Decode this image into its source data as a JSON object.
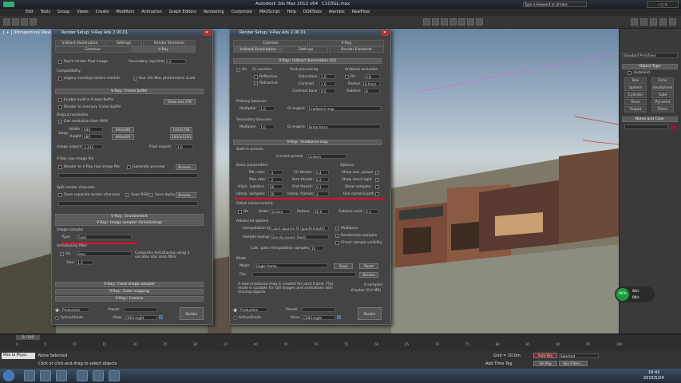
{
  "title_bar": {
    "title": "Autodesk 3ds Max  2012 x64",
    "file": "C103GL.max",
    "search_placeholder": "Type a keyword or phrase"
  },
  "menu": [
    "Edit",
    "Tools",
    "Group",
    "Views",
    "Create",
    "Modifiers",
    "Animation",
    "Graph Editors",
    "Rendering",
    "Customize",
    "MAXScript",
    "Help",
    "DDKTools",
    "Alembic",
    "RealFlow"
  ],
  "viewport": {
    "label": "[ + ] [Perspective] [Realistic]"
  },
  "dialog1": {
    "title": "Render Setup: V-Ray Adv 2.00.01",
    "tabs": [
      "Indirect illumination",
      "Settings",
      "Render Elements",
      "Common",
      "V-Ray"
    ],
    "rollouts": {
      "frame_buffer": "V-Ray:: Frame buffer",
      "environment": "V-Ray:: Environment",
      "image_sampler": "V-Ray:: Image sampler (Antialiasing)",
      "fixed_sampler": "V-Ray:: Fixed image sampler",
      "color_mapping": "V-Ray:: Color mapping",
      "camera": "V-Ray:: Camera"
    },
    "lines": {
      "dont_render": "Don't render final image",
      "secondary_rays": "Secondary rays bias",
      "secondary_value": "0.0",
      "compat": "Compatibility",
      "legacy": "Legacy sun/sky/camera models",
      "photometric": "Use 3ds Max photometric scale",
      "enable_fb": "Enable built-in Frame Buffer",
      "render_memory": "Render to memory frame buffer",
      "show_last": "Show last VFB",
      "output_res": "Output resolution",
      "get_res": "Get resolution from MAX",
      "width": "Width",
      "width_val": "640",
      "height": "Height",
      "height_val": "480",
      "swap": "Swap",
      "r640": "640x480",
      "r1024": "1024x768",
      "r800": "800x600",
      "r1600": "1600x1200",
      "image_aspect": "Image aspect:",
      "image_aspect_val": "1.333",
      "pixel_aspect": "Pixel aspect:",
      "pixel_aspect_val": "1.0",
      "vray_raw": "V-Ray raw image file",
      "render_raw": "Render to V-Ray raw image file",
      "gen_preview": "Generate preview",
      "browse": "Browse...",
      "split_channels": "Split render channels",
      "save_split": "Save separate render channels",
      "save_rgb": "Save RGB",
      "save_alpha": "Save alpha",
      "image_sampler_grp": "Image sampler",
      "type": "Type:",
      "type_val": "Fixed",
      "aa_filter": "Antialiasing filter",
      "on": "On",
      "filter_val": "Area",
      "filter_desc": "Computes Antialiasing using a variable size area filter.",
      "size": "Size:",
      "size_val": "1.5"
    },
    "bottom": {
      "production": "Production",
      "activeshade": "ActiveShade",
      "preset": "Preset:",
      "view": "View:",
      "view_val": "C003-night",
      "render": "Render"
    }
  },
  "dialog2": {
    "title": "Render Setup: V-Ray Adv 2.00.01",
    "tabs": [
      "Common",
      "V-Ray",
      "Indirect illumination",
      "Settings",
      "Render Elements"
    ],
    "rollouts": {
      "gi": "V-Ray:: Indirect illumination (GI)",
      "irradiance": "V-Ray:: Irradiance map"
    },
    "lines": {
      "on": "On",
      "gi_caustics": "GI caustics",
      "reflective": "Reflective",
      "refractive": "Refractive",
      "post": "Post-processing",
      "saturation": "Saturation",
      "saturation_val": "1.0",
      "contrast": "Contrast",
      "contrast_val": "1.0",
      "contrast_base": "Contrast base",
      "contrast_base_val": "0.5",
      "ao": "Ambient occlusion",
      "ao_on": "On",
      "ao_val": "0.8",
      "radius": "Radius",
      "radius_val": "10.0mm",
      "subdivs": "Subdivs",
      "subdivs_val": "8",
      "primary": "Primary bounces",
      "multiplier": "Multiplier",
      "mult_val": "1.0",
      "gi_engine": "GI engine",
      "primary_engine": "Irradiance map",
      "secondary": "Secondary bounces",
      "secondary_engine": "Brute force",
      "builtin": "Built-in presets",
      "current_preset": "Current preset:",
      "preset_val": "Custom",
      "basic": "Basic parameters",
      "min_rate": "Min rate:",
      "min_rate_val": "-3",
      "max_rate": "Max rate:",
      "max_rate_val": "-2",
      "hsph": "HSph. subdivs:",
      "hsph_val": "50",
      "interp": "Interp. samples:",
      "interp_val": "20",
      "clr": "Clr thresh:",
      "clr_val": "0.4",
      "nrm": "Nrm thresh:",
      "nrm_val": "0.2",
      "dist": "Dist thresh:",
      "dist_val": "0.1",
      "frames": "Interp. frames:",
      "frames_val": "2",
      "options": "Options",
      "show_calc": "Show calc. phase",
      "show_direct": "Show direct light",
      "show_samples": "Show samples",
      "use_camera": "Use camera path",
      "detail": "Detail enhancement",
      "detail_on": "On",
      "scale": "Scale:",
      "scale_val": "Screen",
      "det_radius": "Radius:",
      "det_radius_val": "60.0",
      "subdivs_mult": "Subdivs mult.",
      "subdivs_mult_val": "0.3",
      "advanced": "Advanced options",
      "interpolation": "Interpolation type:",
      "interp_type": "Least squares fit (good/smooth)",
      "multipass": "Multipass",
      "randomize": "Randomize samples",
      "check_vis": "Check sample visibility",
      "lookup": "Sample lookup:",
      "lookup_val": "Density-based (best)",
      "calc_pass": "Calc. pass interpolation samples:",
      "calc_pass_val": "10",
      "mode": "Mode",
      "mode_lbl": "Mode:",
      "mode_val": "Single frame",
      "save": "Save",
      "reset": "Reset",
      "file": "File:",
      "browse": "Browse",
      "desc": "A new irradiance map is created for each frame. This mode is suitable for still images and animations with moving objects.",
      "samples": "0 samples",
      "bytes": "0 bytes (0.0 MB)"
    },
    "bottom": {
      "production": "Production",
      "activeshade": "ActiveShade",
      "preset": "Preset:",
      "view": "View:",
      "view_val": "C003-night",
      "render": "Render"
    }
  },
  "command_panel": {
    "object_type": "Object Type",
    "autogrid": "AutoGrid",
    "standard": "Standard Primitives",
    "buttons": [
      "Box",
      "Cone",
      "Sphere",
      "GeoSphere",
      "Cylinder",
      "Tube",
      "Torus",
      "Pyramid",
      "Teapot",
      "Plane"
    ],
    "name_color": "Name and Color"
  },
  "timeline": {
    "frame": "0 / 100",
    "ticks": [
      "0",
      "5",
      "10",
      "15",
      "20",
      "25",
      "30",
      "35",
      "40",
      "45",
      "50",
      "55",
      "60",
      "65",
      "70",
      "75",
      "80",
      "85",
      "90",
      "95",
      "100"
    ]
  },
  "status": {
    "none_selected": "None Selected",
    "hint": "Click or click-and-drag to select objects",
    "script_label": "Max to Physc",
    "grid": "Grid = 10.0m",
    "autokey": "Auto Key",
    "selected": "Selected",
    "setkey": "Set Key",
    "keyfilters": "Key Filters...",
    "add_tag": "Add Time Tag"
  },
  "overlay": {
    "progress": "96%",
    "up": "0K/s",
    "down": "0K/s"
  },
  "clock": {
    "time": "16:42",
    "date": "2015/5/24"
  }
}
